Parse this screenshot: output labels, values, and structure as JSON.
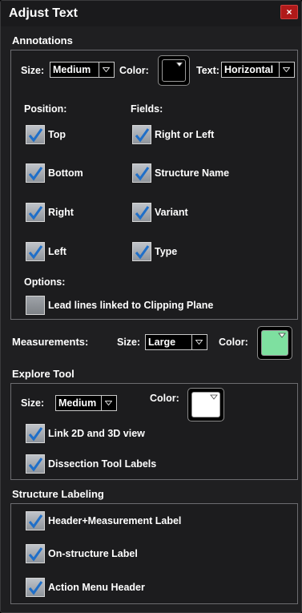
{
  "window": {
    "title": "Adjust Text",
    "close_icon": "close-icon"
  },
  "annotations": {
    "title": "Annotations",
    "size_label": "Size:",
    "size_value": "Medium",
    "color_label": "Color:",
    "color_value": "#000000",
    "text_label": "Text:",
    "text_value": "Horizontal",
    "position_title": "Position:",
    "fields_title": "Fields:",
    "positions": [
      {
        "label": "Top",
        "checked": true
      },
      {
        "label": "Bottom",
        "checked": true
      },
      {
        "label": "Right",
        "checked": true
      },
      {
        "label": "Left",
        "checked": true
      }
    ],
    "fields": [
      {
        "label": "Right or Left",
        "checked": true
      },
      {
        "label": "Structure Name",
        "checked": true
      },
      {
        "label": "Variant",
        "checked": true
      },
      {
        "label": "Type",
        "checked": true
      }
    ],
    "options_title": "Options:",
    "options": [
      {
        "label": "Lead lines linked to Clipping Plane",
        "checked": false
      }
    ]
  },
  "measurements": {
    "title": "Measurements:",
    "size_label": "Size:",
    "size_value": "Large",
    "color_label": "Color:",
    "color_value": "#7ee0a0"
  },
  "explore_tool": {
    "title": "Explore Tool",
    "size_label": "Size:",
    "size_value": "Medium",
    "color_label": "Color:",
    "color_value": "#ffffff",
    "options": [
      {
        "label": "Link 2D and 3D view",
        "checked": true
      },
      {
        "label": "Dissection Tool Labels",
        "checked": true
      }
    ]
  },
  "structure_labeling": {
    "title": "Structure Labeling",
    "options": [
      {
        "label": "Header+Measurement Label",
        "checked": true
      },
      {
        "label": "On-structure Label",
        "checked": true
      },
      {
        "label": "Action Menu Header",
        "checked": true
      }
    ]
  },
  "colors": {
    "accent_check": "#1f6fc9",
    "checkbox_face": "#a9adb3",
    "background": "#1f1f21",
    "close_red": "#b01a1a"
  }
}
